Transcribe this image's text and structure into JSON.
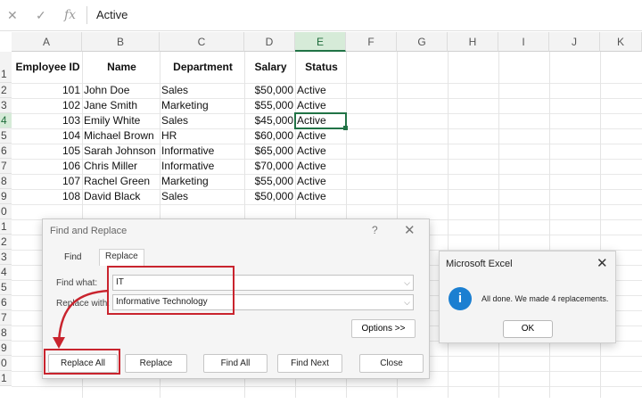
{
  "formula_bar": {
    "cancel_icon": "x-icon",
    "enter_icon": "check-icon",
    "function_icon": "fx",
    "value": "Active"
  },
  "columns": [
    "A",
    "B",
    "C",
    "D",
    "E",
    "F",
    "G",
    "H",
    "I",
    "J",
    "K"
  ],
  "selected_column": "E",
  "rows": [
    "1",
    "2",
    "3",
    "4",
    "5",
    "6",
    "7",
    "8",
    "9",
    "0",
    "1",
    "2",
    "3",
    "4",
    "5",
    "6",
    "7",
    "8",
    "9",
    "0",
    "1"
  ],
  "table": {
    "headers": [
      "Employee ID",
      "Name",
      "Department",
      "Salary",
      "Status"
    ],
    "records": [
      [
        "101",
        "John Doe",
        "Sales",
        "$50,000",
        "Active"
      ],
      [
        "102",
        "Jane Smith",
        "Marketing",
        "$55,000",
        "Active"
      ],
      [
        "103",
        "Emily White",
        "Sales",
        "$45,000",
        "Active"
      ],
      [
        "104",
        "Michael Brown",
        "HR",
        "$60,000",
        "Active"
      ],
      [
        "105",
        "Sarah Johnson",
        "Informative",
        "$65,000",
        "Active"
      ],
      [
        "106",
        "Chris Miller",
        "Informative",
        "$70,000",
        "Active"
      ],
      [
        "107",
        "Rachel Green",
        "Marketing",
        "$55,000",
        "Active"
      ],
      [
        "108",
        "David Black",
        "Sales",
        "$50,000",
        "Active"
      ]
    ]
  },
  "find_replace": {
    "title": "Find and Replace",
    "help": "?",
    "close": "✕",
    "tabs": [
      "Find",
      "Replace"
    ],
    "find_label": "Find what:",
    "find_value": "IT",
    "replace_label": "Replace with:",
    "replace_value": "Informative Technology",
    "options_label": "Options >>",
    "buttons": {
      "replace_all": "Replace All",
      "replace": "Replace",
      "find_all": "Find All",
      "find_next": "Find Next",
      "close": "Close"
    }
  },
  "message_box": {
    "title": "Microsoft Excel",
    "close": "✕",
    "icon": "i",
    "text": "All done. We made 4 replacements.",
    "ok": "OK"
  },
  "colors": {
    "excel_green": "#217346",
    "annotation_red": "#c9242e",
    "info_blue": "#1b7fd1"
  }
}
